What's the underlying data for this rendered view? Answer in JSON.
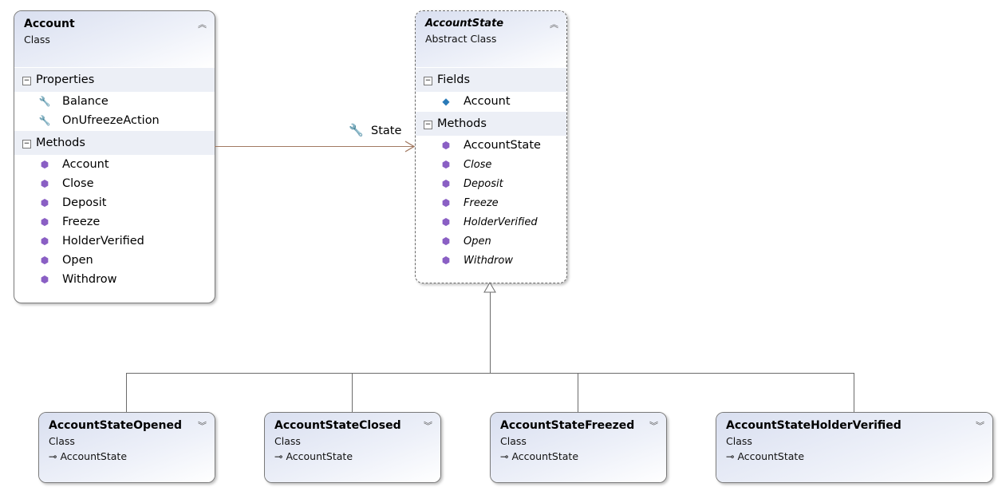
{
  "colors": {
    "association": "#a27a62",
    "header": "#d9dff0",
    "section": "#eceff6"
  },
  "account": {
    "name": "Account",
    "stereotype": "Class",
    "collapse_icon": "collapse-chevron-up",
    "sections": [
      {
        "label": "Properties",
        "kind": "property",
        "members": [
          "Balance",
          "OnUfreezeAction"
        ]
      },
      {
        "label": "Methods",
        "kind": "method",
        "members": [
          "Account",
          "Close",
          "Deposit",
          "Freeze",
          "HolderVerified",
          "Open",
          "Withdrow"
        ]
      }
    ]
  },
  "account_state": {
    "name": "AccountState",
    "stereotype": "Abstract Class",
    "collapse_icon": "collapse-chevron-up",
    "sections": [
      {
        "label": "Fields",
        "kind": "field",
        "members": [
          "Account"
        ]
      },
      {
        "label": "Methods",
        "kind": "method-protected",
        "members": [
          "AccountState",
          "Close",
          "Deposit",
          "Freeze",
          "HolderVerified",
          "Open",
          "Withdrow"
        ],
        "italic_from": 1
      }
    ]
  },
  "association": {
    "label": "State",
    "icon": "wrench-property"
  },
  "subclasses": [
    {
      "name": "AccountStateOpened",
      "stereotype": "Class",
      "base": "AccountState"
    },
    {
      "name": "AccountStateClosed",
      "stereotype": "Class",
      "base": "AccountState"
    },
    {
      "name": "AccountStateFreezed",
      "stereotype": "Class",
      "base": "AccountState"
    },
    {
      "name": "AccountStateHolderVerified",
      "stereotype": "Class",
      "base": "AccountState"
    }
  ]
}
